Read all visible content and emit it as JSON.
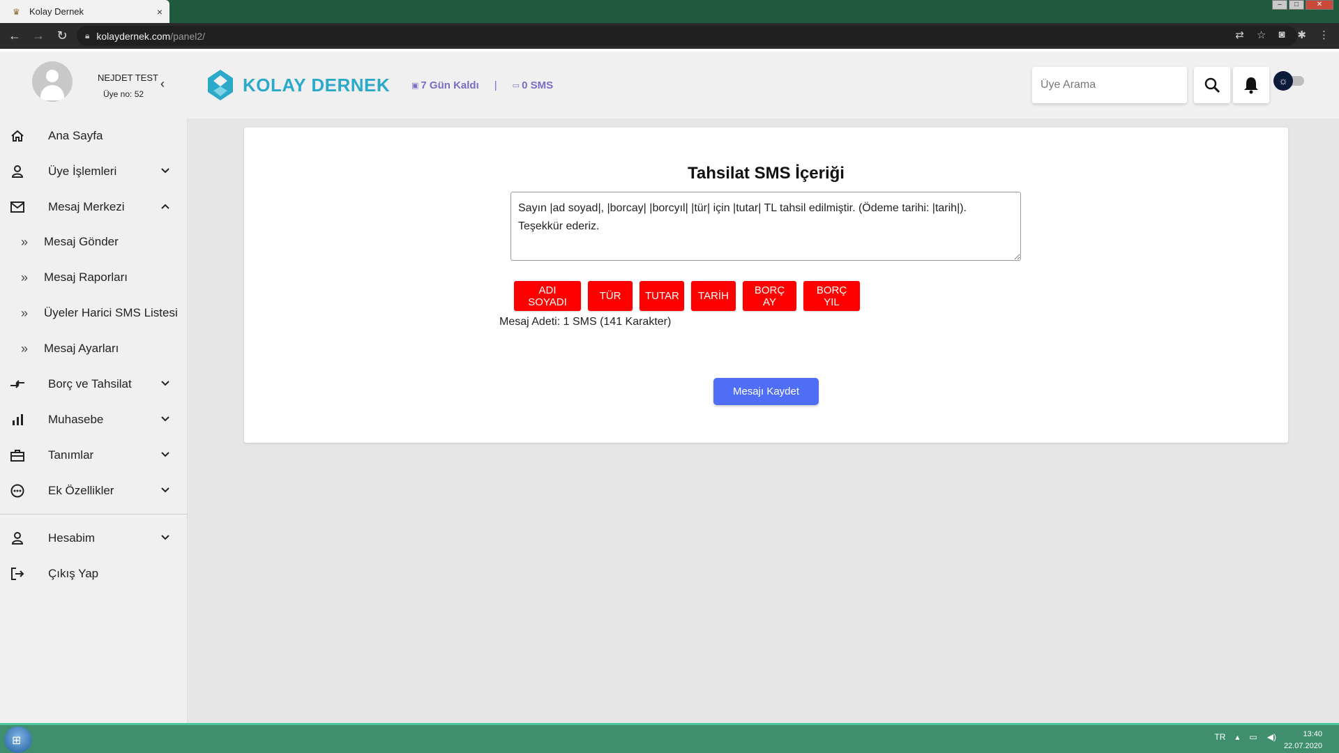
{
  "browser": {
    "tab_title": "Kolay Dernek",
    "tab_close": "×",
    "url_host": "kolaydernek.com",
    "url_path": "/panel2/"
  },
  "header": {
    "user_name": "NEJDET TEST",
    "user_no": "Üye no: 52",
    "brand": "KOLAY DERNEK",
    "days_left": "7 Gün Kaldı",
    "separator": "|",
    "sms_count": "0 SMS",
    "search_placeholder": "Üye Arama"
  },
  "sidebar": {
    "items": [
      {
        "label": "Ana Sayfa",
        "icon": "home-icon"
      },
      {
        "label": "Üye İşlemleri",
        "icon": "person-icon"
      },
      {
        "label": "Mesaj Merkezi",
        "icon": "mail-icon"
      },
      {
        "label": "Borç ve Tahsilat",
        "icon": "transfer-icon"
      },
      {
        "label": "Muhasebe",
        "icon": "bar-chart-icon"
      },
      {
        "label": "Tanımlar",
        "icon": "briefcase-icon"
      },
      {
        "label": "Ek Özellikler",
        "icon": "more-circle-icon"
      },
      {
        "label": "Hesabim",
        "icon": "person-icon"
      },
      {
        "label": "Çıkış Yap",
        "icon": "logout-icon"
      }
    ],
    "sub_items": [
      {
        "label": "Mesaj Gönder"
      },
      {
        "label": "Mesaj Raporları"
      },
      {
        "label": "Üyeler Harici SMS Listesi"
      },
      {
        "label": "Mesaj Ayarları"
      }
    ]
  },
  "main": {
    "title": "Tahsilat SMS İçeriği",
    "sms_content": "Sayın |ad soyad|, |borcay| |borcyıl| |tür| için |tutar| TL tahsil edilmiştir. (Ödeme tarihi: |tarih|). Teşekkür ederiz.",
    "variable_buttons": [
      "ADI SOYADI",
      "TÜR",
      "TUTAR",
      "TARİH",
      "BORÇ AY",
      "BORÇ YIL"
    ],
    "message_count": "Mesaj Adeti: 1 SMS (141 Karakter)",
    "save_label": "Mesajı Kaydet"
  },
  "taskbar": {
    "lang": "TR",
    "time": "13:40",
    "date": "22.07.2020"
  },
  "colors": {
    "brand": "#2aa9c9",
    "accent_purple": "#7b6bc7",
    "variable_red": "#ff0000",
    "save_blue": "#4f6ef5",
    "taskbar_green": "#3f8f6e"
  }
}
